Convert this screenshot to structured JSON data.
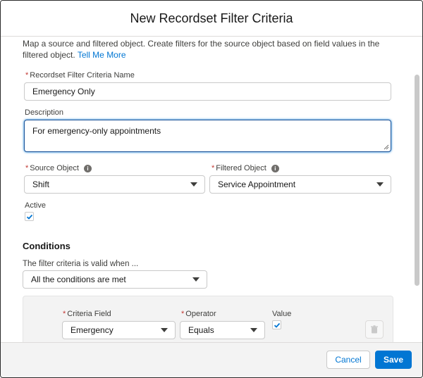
{
  "dialog": {
    "title": "New Recordset Filter Criteria",
    "intro_text": "Map a source and filtered object. Create filters for the source object based on field values in the filtered object.",
    "intro_link": "Tell Me More"
  },
  "form": {
    "name_label": "Recordset Filter Criteria Name",
    "name_value": "Emergency Only",
    "description_label": "Description",
    "description_value": "For emergency-only appointments",
    "source_object_label": "Source Object",
    "source_object_value": "Shift",
    "filtered_object_label": "Filtered Object",
    "filtered_object_value": "Service Appointment",
    "active_label": "Active",
    "active_checked": true,
    "required_marker": "*",
    "info_icon_glyph": "i"
  },
  "conditions": {
    "title": "Conditions",
    "valid_when_label": "The filter criteria is valid when ...",
    "valid_when_value": "All the conditions are met",
    "criteria_field_label": "Criteria Field",
    "criteria_field_value": "Emergency",
    "operator_label": "Operator",
    "operator_value": "Equals",
    "value_label": "Value",
    "value_checked": true
  },
  "footer": {
    "cancel_label": "Cancel",
    "save_label": "Save"
  },
  "colors": {
    "brand": "#0176d3",
    "required": "#c23934",
    "border": "#c9c9c9"
  },
  "icons": [
    "info-icon",
    "chevron-down-icon",
    "checkmark-icon",
    "trash-icon",
    "resize-handle-icon"
  ]
}
